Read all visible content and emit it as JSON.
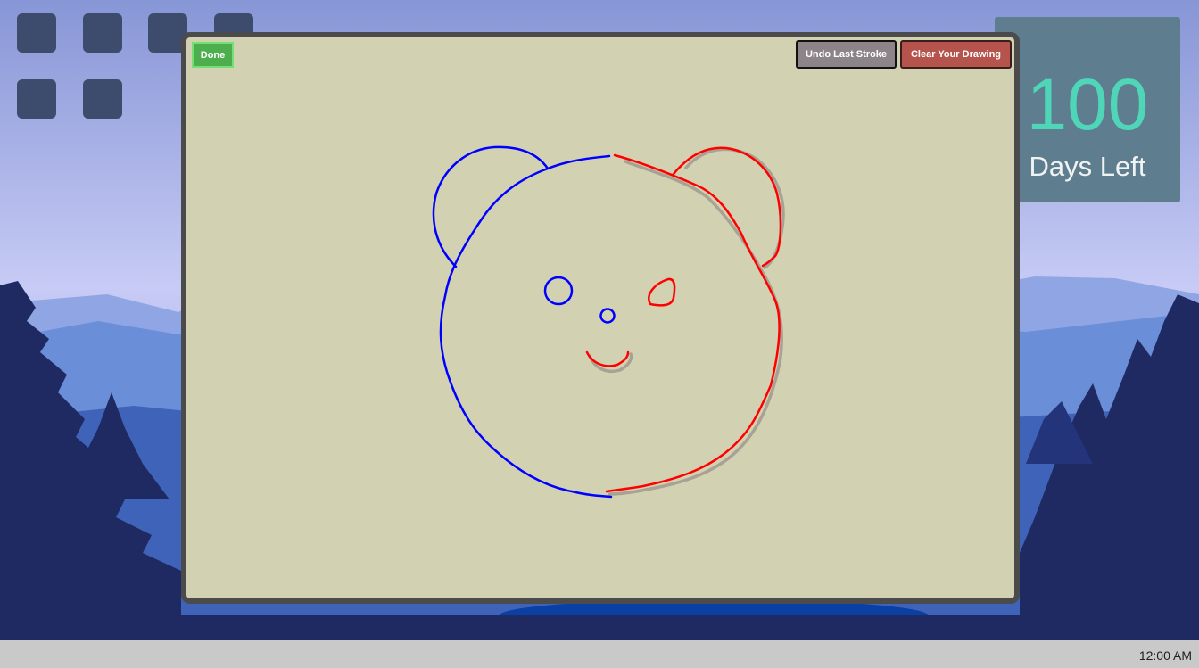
{
  "drawing": {
    "done_label": "Done",
    "undo_label": "Undo Last Stroke",
    "clear_label": "Clear Your Drawing",
    "canvas_color": "#d2d2b2",
    "stroke_colors": {
      "left": "#0000ff",
      "right": "#ff0000",
      "shadow": "#a8a294"
    }
  },
  "countdown": {
    "number": "100",
    "label": "Days Left",
    "number_color": "#4fd6b8"
  },
  "taskbar": {
    "clock": "12:00 AM"
  },
  "desktop": {
    "icon_color": "#3d4b6d"
  }
}
